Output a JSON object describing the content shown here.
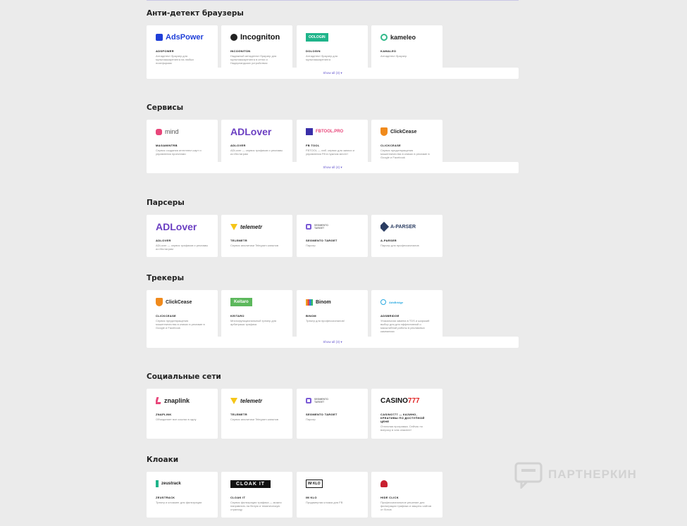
{
  "sections": [
    {
      "title": "Анти-детект браузеры",
      "show_all": "Show all (3) ▾",
      "cards": [
        {
          "logo": "AdsPower",
          "name": "ADSPOWER",
          "desc": "Антидетект браузер для мультиаккаунтинга на любых платформах"
        },
        {
          "logo": "Incogniton",
          "name": "INCOGNITON",
          "desc": "Надежный антидетект браузер для мультиаккаунтинга в сетях и Нидерландских устройствах"
        },
        {
          "logo": "OOLOGIN",
          "name": "DOLOGIN",
          "desc": "Антидетект браузер для мультиаккаунтинга"
        },
        {
          "logo": "kameleo",
          "name": "KAMALEO",
          "desc": "Антидетект браузер"
        }
      ]
    },
    {
      "title": "Сервисы",
      "show_all": "Show all (4) ▾",
      "cards": [
        {
          "logo": "mind",
          "name": "MAGAMINTRB",
          "desc": "Сервис создания интеллект-карт и управления проектами"
        },
        {
          "logo": "ADLover",
          "name": "ADLOVER",
          "desc": "ADLover — сервис графиков и рекламы из Инстаграм"
        },
        {
          "logo": "FBTOOL.PRO",
          "name": "FB TOOL",
          "desc": "FBTOOL — лаб. сервис для записи и управления FB в нужном месте!"
        },
        {
          "logo": "ClickCease",
          "name": "CLICKCEASE",
          "desc": "Сервис предотвращения мошенничества в кликах в рекламе в Google и Facebook"
        }
      ]
    },
    {
      "title": "Парсеры",
      "show_all": "",
      "cards": [
        {
          "logo": "ADLover",
          "name": "ADLOVER",
          "desc": "ADLover — сервис графиков и рекламы из Инстаграм"
        },
        {
          "logo": "telemetr",
          "name": "TELEMETR",
          "desc": "Сервис аналитики Telegram каналов"
        },
        {
          "logo": "SEGMENTO TARGET",
          "name": "SEGMENTO TARGET",
          "desc": "Парсер"
        },
        {
          "logo": "A-PARSER",
          "name": "A-PARSER",
          "desc": "Парсер для профессионалов"
        }
      ]
    },
    {
      "title": "Трекеры",
      "show_all": "Show all (3) ▾",
      "cards": [
        {
          "logo": "ClickCease",
          "name": "CLICKCEASE",
          "desc": "Сервис предотвращения мошенничества в кликах в рекламе в Google и Facebook"
        },
        {
          "logo": "Keitaro",
          "name": "KEITARO",
          "desc": "Многофункциональный трекер для арбитража трафика"
        },
        {
          "logo": "Binom",
          "name": "BINOM",
          "desc": "Трекер для профессионалов!"
        },
        {
          "logo": "AdsBridge",
          "name": "ADSBRIDGE",
          "desc": "Уникальная замена в TDS и широкий выбор для для эффективной и масштабной работы в рекламных кампаниях"
        }
      ]
    },
    {
      "title": "Социальные сети",
      "show_all": "",
      "cards": [
        {
          "logo": "znaplink",
          "name": "ZNAPLINK",
          "desc": "Объединяет все ссылки в одну"
        },
        {
          "logo": "telemetr",
          "name": "TELEMETR",
          "desc": "Сервис аналитики Telegram каналов"
        },
        {
          "logo": "SEGMENTO TARGET",
          "name": "SEGMENTO TARGET",
          "desc": "Парсер"
        },
        {
          "logo": "CASINO777",
          "name": "CASINO777 — КАЗИНО, КРЕАТИВЫ ПО ДОСТУПНОЙ ЦЕНЕ",
          "desc": "Отличная програмка. Сейчас по вопросу в чем опаснее!"
        }
      ]
    },
    {
      "title": "Клоаки",
      "show_all": "",
      "cards": [
        {
          "logo": "zeustrack",
          "name": "ZEUSTRACK",
          "desc": "Трекер и клоакинг для фильтрации"
        },
        {
          "logo": "CLOAK IT",
          "name": "CLOAK IT",
          "desc": "Сервис фильтрации трафика — можно направлять на белую и тематическую страницу"
        },
        {
          "logo": "IM KLO",
          "name": "IM KLO",
          "desc": "Продвинутая клоака для FB"
        },
        {
          "logo": "HIDE CLICK",
          "name": "HIDE CLICK",
          "desc": "Профессиональное решение для фильтрации трафика и защиты сайтов от ботов"
        }
      ]
    }
  ],
  "watermark": "ПАРТНЕРКИН",
  "colors": {
    "background": "#ebebeb",
    "card": "#ffffff",
    "showall_text": "#6a5ccf",
    "adspower": "#1f3fd8",
    "adlover": "#6b3fc2",
    "fbtool": "#3a2fa8",
    "clickcease": "#f08a1c",
    "keitaro": "#5cb85c",
    "cloakit_bg": "#111111",
    "znaplink": "#e8467a"
  }
}
